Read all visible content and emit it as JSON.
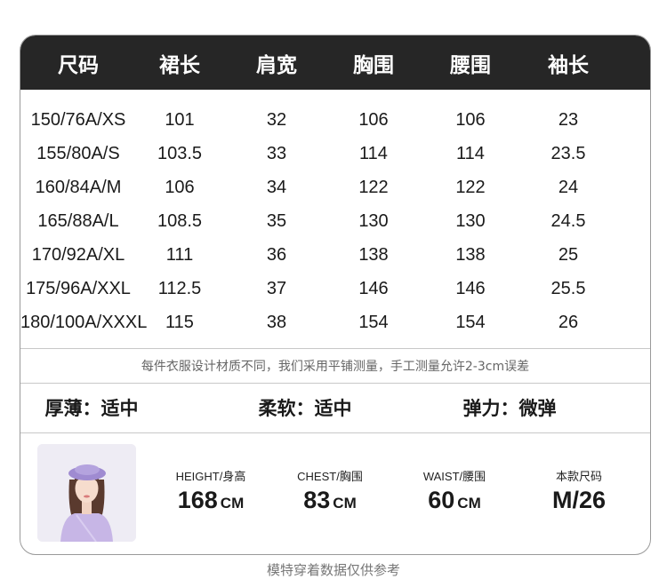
{
  "table": {
    "headers": [
      "尺码",
      "裙长",
      "肩宽",
      "胸围",
      "腰围",
      "袖长"
    ],
    "rows": [
      [
        "150/76A/XS",
        "101",
        "32",
        "106",
        "106",
        "23"
      ],
      [
        "155/80A/S",
        "103.5",
        "33",
        "114",
        "114",
        "23.5"
      ],
      [
        "160/84A/M",
        "106",
        "34",
        "122",
        "122",
        "24"
      ],
      [
        "165/88A/L",
        "108.5",
        "35",
        "130",
        "130",
        "24.5"
      ],
      [
        "170/92A/XL",
        "111",
        "36",
        "138",
        "138",
        "25"
      ],
      [
        "175/96A/XXL",
        "112.5",
        "37",
        "146",
        "146",
        "25.5"
      ],
      [
        "180/100A/XXXL",
        "115",
        "38",
        "154",
        "154",
        "26"
      ]
    ]
  },
  "note": "每件衣服设计材质不同，我们采用平铺测量，手工测量允许2-3cm误差",
  "attributes": [
    "厚薄：适中",
    "柔软：适中",
    "弹力：微弹"
  ],
  "model": {
    "height": {
      "label": "HEIGHT/身高",
      "value": "168",
      "unit": "CM"
    },
    "chest": {
      "label": "CHEST/胸围",
      "value": "83",
      "unit": "CM"
    },
    "waist": {
      "label": "WAIST/腰围",
      "value": "60",
      "unit": "CM"
    },
    "size": {
      "label": "本款尺码",
      "value": "M/26"
    }
  },
  "footer": "模特穿着数据仅供参考"
}
